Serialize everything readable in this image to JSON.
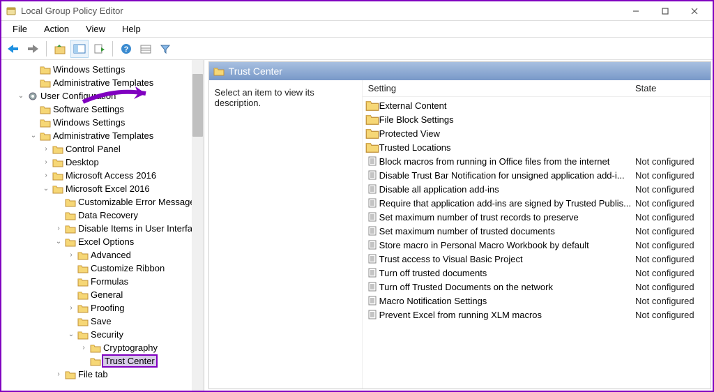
{
  "window": {
    "title": "Local Group Policy Editor"
  },
  "menubar": [
    "File",
    "Action",
    "View",
    "Help"
  ],
  "tree": {
    "nodes": [
      {
        "label": "Windows Settings",
        "indent": 2,
        "kind": "f",
        "exp": ""
      },
      {
        "label": "Administrative Templates",
        "indent": 2,
        "kind": "f",
        "exp": ""
      },
      {
        "label": "User Configuration",
        "indent": 1,
        "kind": "g",
        "exp": "▾"
      },
      {
        "label": "Software Settings",
        "indent": 2,
        "kind": "f",
        "exp": ""
      },
      {
        "label": "Windows Settings",
        "indent": 2,
        "kind": "f",
        "exp": ""
      },
      {
        "label": "Administrative Templates",
        "indent": 2,
        "kind": "f",
        "exp": "▾"
      },
      {
        "label": "Control Panel",
        "indent": 3,
        "kind": "f",
        "exp": "▸"
      },
      {
        "label": "Desktop",
        "indent": 3,
        "kind": "f",
        "exp": "▸"
      },
      {
        "label": "Microsoft Access 2016",
        "indent": 3,
        "kind": "f",
        "exp": "▸"
      },
      {
        "label": "Microsoft Excel 2016",
        "indent": 3,
        "kind": "f",
        "exp": "▾"
      },
      {
        "label": "Customizable Error Messages",
        "indent": 4,
        "kind": "f",
        "exp": ""
      },
      {
        "label": "Data Recovery",
        "indent": 4,
        "kind": "f",
        "exp": ""
      },
      {
        "label": "Disable Items in User Interface",
        "indent": 4,
        "kind": "f",
        "exp": "▸"
      },
      {
        "label": "Excel Options",
        "indent": 4,
        "kind": "f",
        "exp": "▾"
      },
      {
        "label": "Advanced",
        "indent": 5,
        "kind": "f",
        "exp": "▸"
      },
      {
        "label": "Customize Ribbon",
        "indent": 5,
        "kind": "f",
        "exp": ""
      },
      {
        "label": "Formulas",
        "indent": 5,
        "kind": "f",
        "exp": ""
      },
      {
        "label": "General",
        "indent": 5,
        "kind": "f",
        "exp": ""
      },
      {
        "label": "Proofing",
        "indent": 5,
        "kind": "f",
        "exp": "▸"
      },
      {
        "label": "Save",
        "indent": 5,
        "kind": "f",
        "exp": ""
      },
      {
        "label": "Security",
        "indent": 5,
        "kind": "f",
        "exp": "▾"
      },
      {
        "label": "Cryptography",
        "indent": 6,
        "kind": "f",
        "exp": "▸"
      },
      {
        "label": "Trust Center",
        "indent": 6,
        "kind": "f",
        "exp": "",
        "selected": true
      },
      {
        "label": "File tab",
        "indent": 4,
        "kind": "f",
        "exp": "▸"
      }
    ]
  },
  "detail": {
    "title": "Trust Center",
    "desc": "Select an item to view its description.",
    "columns": {
      "setting": "Setting",
      "state": "State"
    },
    "items": [
      {
        "kind": "folder",
        "label": "External Content",
        "state": ""
      },
      {
        "kind": "folder",
        "label": "File Block Settings",
        "state": ""
      },
      {
        "kind": "folder",
        "label": "Protected View",
        "state": ""
      },
      {
        "kind": "folder",
        "label": "Trusted Locations",
        "state": ""
      },
      {
        "kind": "policy",
        "label": "Block macros from running in Office files from the internet",
        "state": "Not configured"
      },
      {
        "kind": "policy",
        "label": "Disable Trust Bar Notification for unsigned application add-i...",
        "state": "Not configured"
      },
      {
        "kind": "policy",
        "label": "Disable all application add-ins",
        "state": "Not configured"
      },
      {
        "kind": "policy",
        "label": "Require that application add-ins are signed by Trusted Publis...",
        "state": "Not configured"
      },
      {
        "kind": "policy",
        "label": "Set maximum number of trust records to preserve",
        "state": "Not configured"
      },
      {
        "kind": "policy",
        "label": "Set maximum number of trusted documents",
        "state": "Not configured"
      },
      {
        "kind": "policy",
        "label": "Store macro in Personal Macro Workbook by default",
        "state": "Not configured"
      },
      {
        "kind": "policy",
        "label": "Trust access to Visual Basic Project",
        "state": "Not configured"
      },
      {
        "kind": "policy",
        "label": "Turn off trusted documents",
        "state": "Not configured"
      },
      {
        "kind": "policy",
        "label": "Turn off Trusted Documents on the network",
        "state": "Not configured"
      },
      {
        "kind": "policy",
        "label": "Macro Notification Settings",
        "state": "Not configured"
      },
      {
        "kind": "policy",
        "label": "Prevent Excel from running XLM macros",
        "state": "Not configured"
      }
    ]
  }
}
